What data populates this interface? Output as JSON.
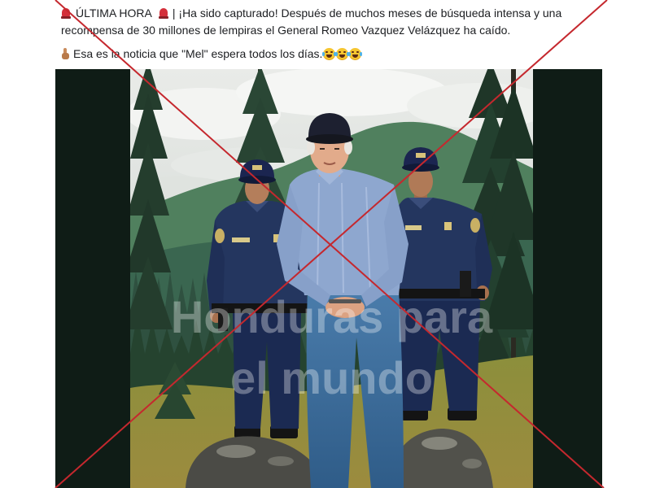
{
  "post": {
    "breaking_label": "ÚLTIMA HORA",
    "headline_line1": "| ¡Ha sido capturado! Después de muchos meses de búsqueda intensa y una",
    "headline_line2": "recompensa de 30 millones de lempiras el General Romeo Vazquez Velázquez ha caído.",
    "comment": "Esa es la noticia que \"Mel\" espera todos los días.",
    "icons": {
      "breaking_before": "siren-icon",
      "breaking_after": "siren-icon",
      "comment_before": "pointing-up-icon",
      "comment_after": [
        "laughing-face-icon",
        "laughing-face-icon",
        "laughing-face-icon"
      ]
    }
  },
  "photo": {
    "watermark": [
      "Honduras para",
      "el mundo"
    ]
  },
  "overlay": {
    "icon": "false-cross-icon"
  },
  "colors": {
    "text": "#1c1e21",
    "background": "#ffffff",
    "photo_frame": "#0f1c16",
    "cross": "#c5282e",
    "siren": "#d42f3a"
  }
}
